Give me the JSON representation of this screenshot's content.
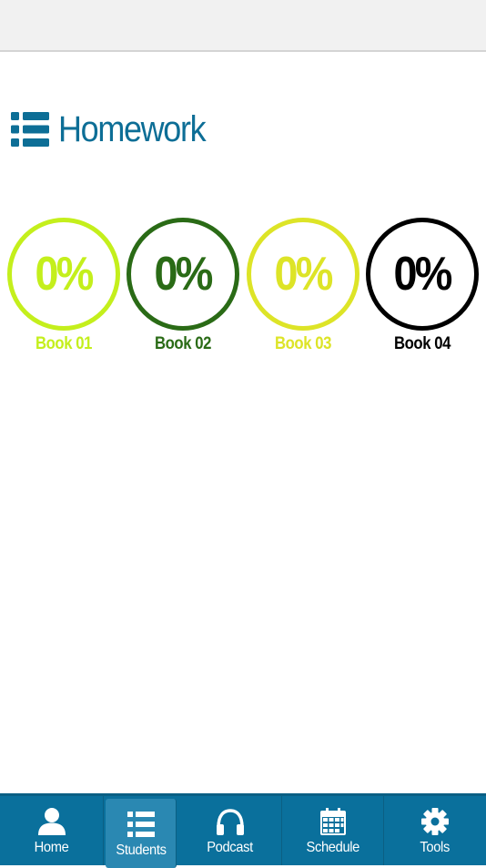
{
  "header": {
    "title": "Homework",
    "icon": "list-icon",
    "color": "#0d6e96"
  },
  "books": [
    {
      "label": "Book 01",
      "percent": "0%",
      "progress": 0,
      "color": "#c4ef1c"
    },
    {
      "label": "Book 02",
      "percent": "0%",
      "progress": 0,
      "color": "#2a6b16"
    },
    {
      "label": "Book 03",
      "percent": "0%",
      "progress": 0,
      "color": "#dde427"
    },
    {
      "label": "Book 04",
      "percent": "0%",
      "progress": 0,
      "color": "#000000"
    }
  ],
  "tab_bar": {
    "background": "#0a709c",
    "active_tab": "Students",
    "tabs": [
      {
        "label": "Home",
        "icon": "person-icon"
      },
      {
        "label": "Students",
        "icon": "list-icon"
      },
      {
        "label": "Podcast",
        "icon": "headphones-icon"
      },
      {
        "label": "Schedule",
        "icon": "calendar-icon"
      },
      {
        "label": "Tools",
        "icon": "gear-icon"
      }
    ]
  }
}
